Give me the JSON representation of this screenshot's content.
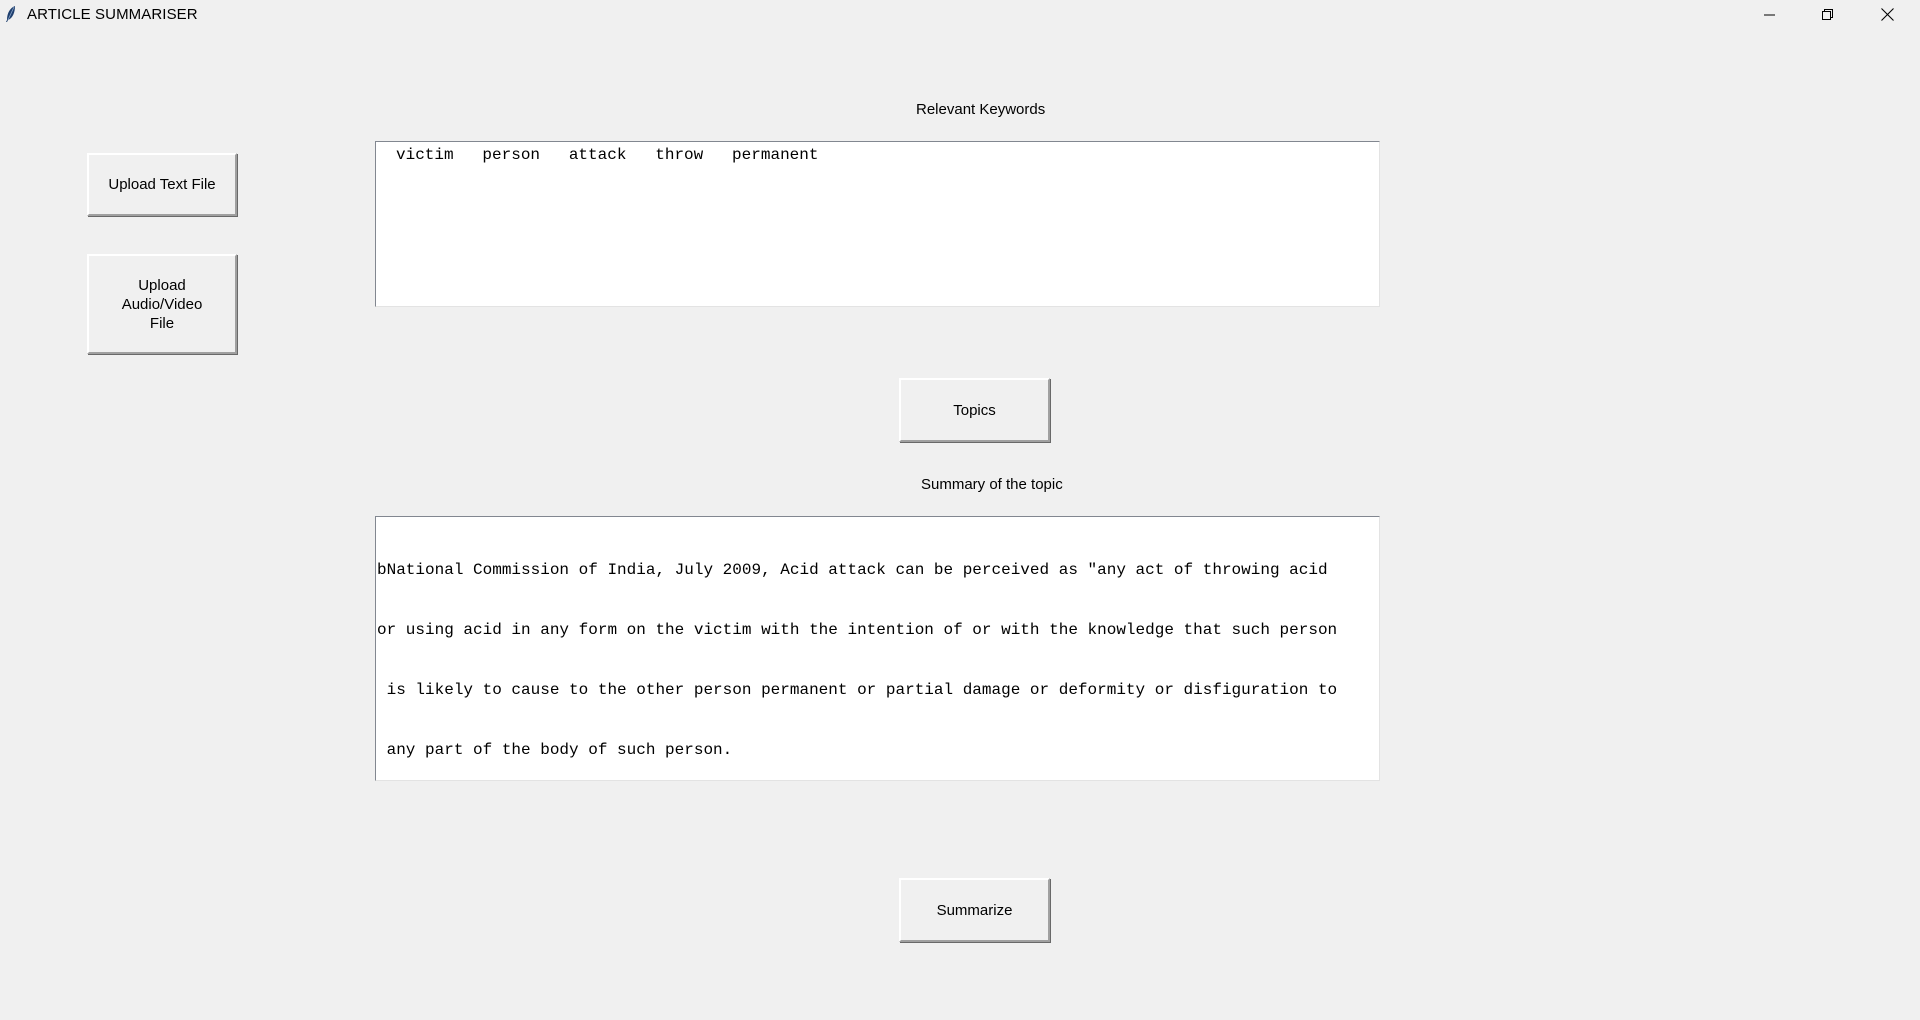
{
  "window": {
    "title": "ARTICLE SUMMARISER",
    "controls": [
      "minimize-icon",
      "restore-icon",
      "close-icon"
    ]
  },
  "buttons": {
    "upload_text": "Upload Text File",
    "upload_av_lines": [
      "Upload",
      "Audio/Video",
      "File"
    ],
    "topics": "Topics",
    "summarize": "Summarize"
  },
  "keywords": {
    "heading": "Relevant Keywords",
    "text": "victim   person   attack   throw   permanent"
  },
  "summary": {
    "heading": "Summary of the topic",
    "lines": [
      "bNational Commission of India, July 2009, Acid attack can be perceived as \"any act of throwing acid",
      "or using acid in any form on the victim with the intention of or with the knowledge that such person",
      " is likely to cause to the other person permanent or partial damage or deformity or disfiguration to",
      " any part of the body of such person."
    ]
  }
}
